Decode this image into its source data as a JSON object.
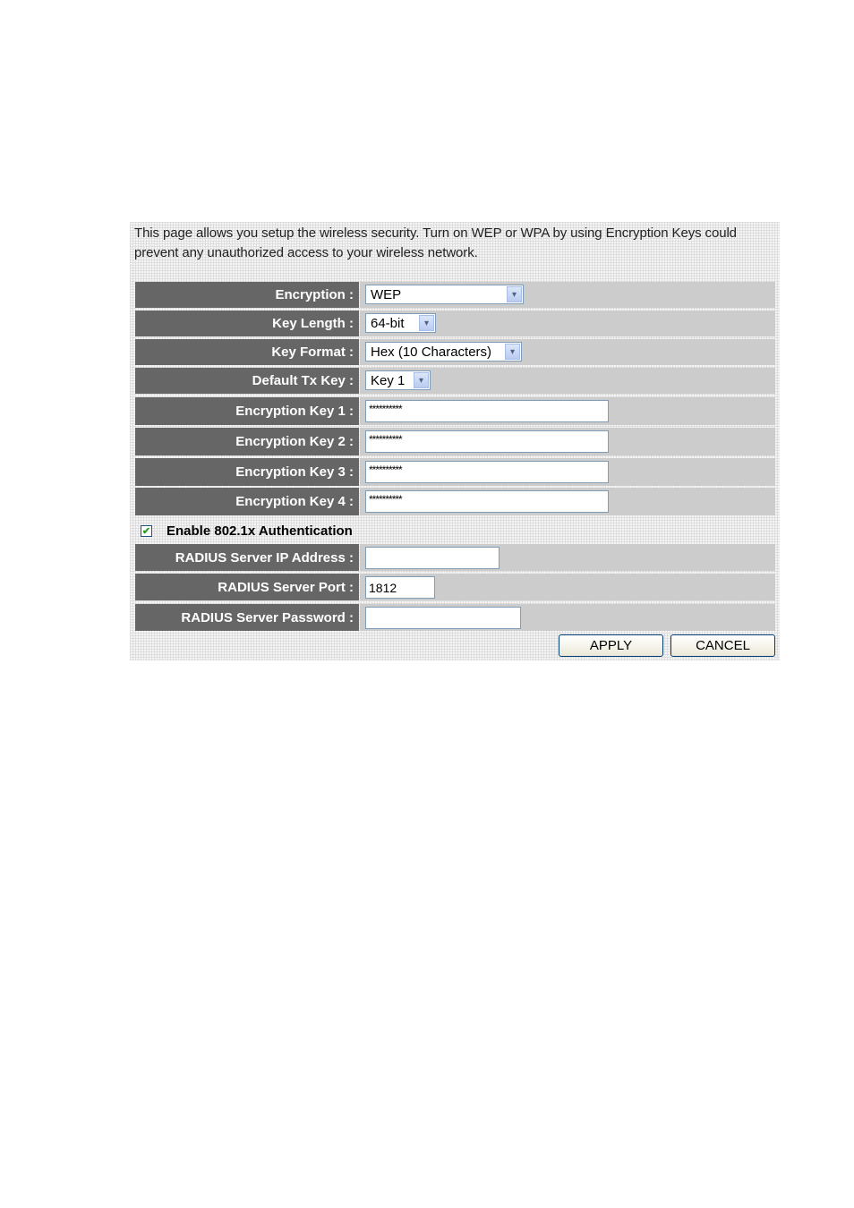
{
  "intro": "This page allows you setup the wireless security. Turn on WEP or WPA by using Encryption Keys could prevent any unauthorized access to your wireless network.",
  "fields": {
    "encryption": {
      "label": "Encryption :",
      "value": "WEP"
    },
    "key_length": {
      "label": "Key Length :",
      "value": "64-bit"
    },
    "key_format": {
      "label": "Key Format :",
      "value": "Hex (10 Characters)"
    },
    "default_tx_key": {
      "label": "Default Tx Key :",
      "value": "Key 1"
    },
    "key1": {
      "label": "Encryption Key 1 :",
      "value": "**********"
    },
    "key2": {
      "label": "Encryption Key 2 :",
      "value": "**********"
    },
    "key3": {
      "label": "Encryption Key 3 :",
      "value": "**********"
    },
    "key4": {
      "label": "Encryption Key 4 :",
      "value": "**********"
    },
    "enable_8021x": {
      "label": "Enable 802.1x Authentication",
      "checked": true
    },
    "radius_ip": {
      "label": "RADIUS Server IP Address :",
      "value": ""
    },
    "radius_port": {
      "label": "RADIUS Server Port :",
      "value": "1812"
    },
    "radius_password": {
      "label": "RADIUS Server Password :",
      "value": ""
    }
  },
  "buttons": {
    "apply": "APPLY",
    "cancel": "CANCEL"
  },
  "icons": {
    "dropdown": "▾",
    "check": "✔"
  }
}
